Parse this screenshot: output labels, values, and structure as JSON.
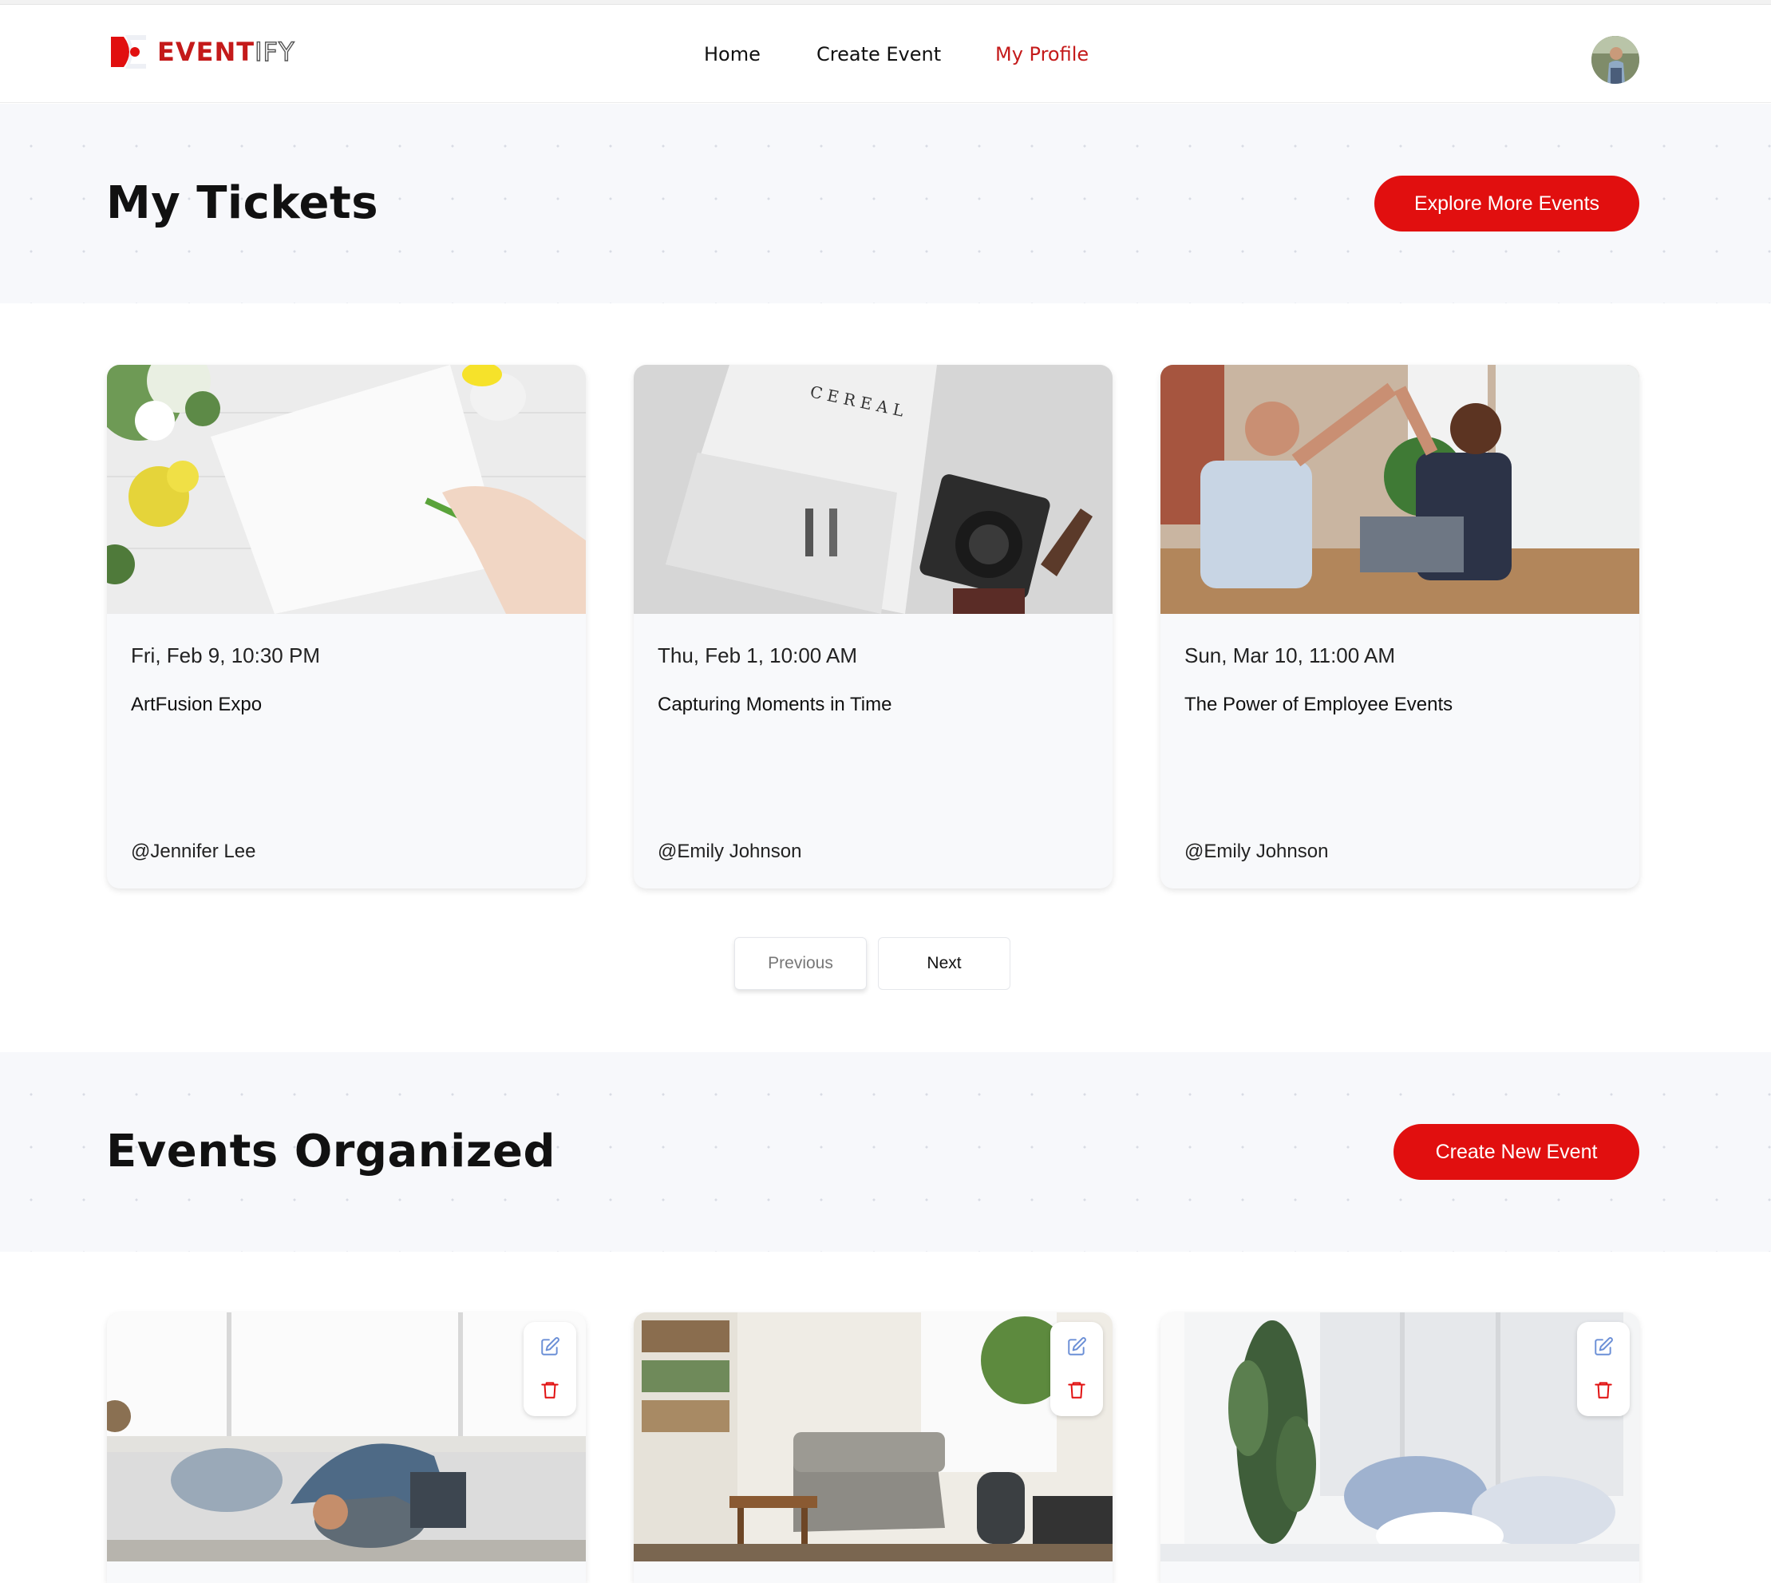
{
  "header": {
    "logo_text_main": "EVENT",
    "logo_text_outline": "IFY",
    "nav": [
      {
        "label": "Home"
      },
      {
        "label": "Create Event"
      },
      {
        "label": "My Profile",
        "active": true
      }
    ]
  },
  "tickets_section": {
    "title": "My Tickets",
    "button_label": "Explore More Events",
    "cards": [
      {
        "date": "Fri, Feb 9, 10:30 PM",
        "title": "ArtFusion Expo",
        "organizer": "@Jennifer Lee",
        "image": "drawing-on-paper-with-flowers"
      },
      {
        "date": "Thu, Feb 1, 10:00 AM",
        "title": "Capturing Moments in Time",
        "organizer": "@Emily Johnson",
        "image": "magazine-and-camera"
      },
      {
        "date": "Sun, Mar 10, 11:00 AM",
        "title": "The Power of Employee Events",
        "organizer": "@Emily Johnson",
        "image": "coworkers-high-five"
      }
    ],
    "pagination": {
      "previous": "Previous",
      "next": "Next"
    }
  },
  "organized_section": {
    "title": "Events Organized",
    "button_label": "Create New Event",
    "cards": [
      {
        "image": "yoga-pose-living-room"
      },
      {
        "image": "cozy-living-room-with-plants"
      },
      {
        "image": "bed-with-pillows-and-plant"
      }
    ]
  },
  "colors": {
    "accent": "#e10f0f",
    "brand": "#c41a1a",
    "banner_bg": "#f7f8fb"
  }
}
